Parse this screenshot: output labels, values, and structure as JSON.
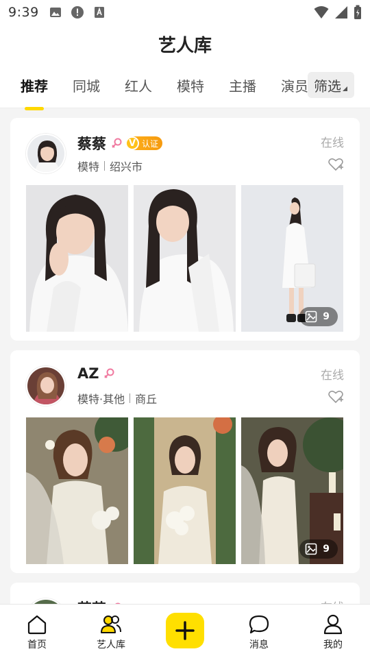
{
  "status_bar": {
    "time": "9:39"
  },
  "header": {
    "title": "艺人库",
    "tabs": [
      {
        "label": "推荐",
        "active": true
      },
      {
        "label": "同城",
        "active": false
      },
      {
        "label": "红人",
        "active": false
      },
      {
        "label": "模特",
        "active": false
      },
      {
        "label": "主播",
        "active": false
      },
      {
        "label": "演员",
        "active": false
      }
    ],
    "filter_label": "筛选"
  },
  "cards": [
    {
      "name": "蔡蔡",
      "verified_badge": "V",
      "verified_label": "认证",
      "role": "模特",
      "city": "绍兴市",
      "status": "在线",
      "photo_count": "9"
    },
    {
      "name": "AZ",
      "role": "模特·其他",
      "city": "商丘",
      "status": "在线",
      "photo_count": "9"
    },
    {
      "name": "艺艺",
      "status": "在线"
    }
  ],
  "bottom_nav": [
    {
      "label": "首页",
      "icon": "home-icon"
    },
    {
      "label": "艺人库",
      "icon": "artists-icon"
    },
    {
      "label": "",
      "icon": "plus-icon"
    },
    {
      "label": "消息",
      "icon": "message-icon"
    },
    {
      "label": "我的",
      "icon": "profile-icon"
    }
  ],
  "colors": {
    "accent": "#ffd800",
    "badge_gold": "#f59a0f",
    "female_pink": "#f07aa0"
  }
}
